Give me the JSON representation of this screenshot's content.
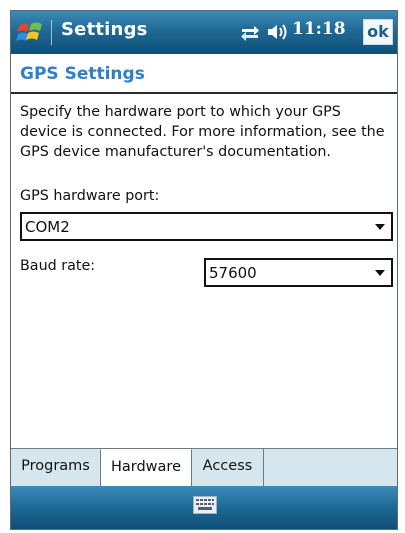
{
  "titlebar": {
    "app_title": "Settings",
    "time": "11:18",
    "ok_label": "ok",
    "icons": [
      "windows-start-icon",
      "connectivity-icon",
      "volume-icon"
    ]
  },
  "page": {
    "title": "GPS Settings",
    "description": "Specify the hardware port to which your GPS device is connected. For more information, see the GPS device manufacturer's documentation."
  },
  "form": {
    "port_label": "GPS hardware port:",
    "port_value": "COM2",
    "baud_label": "Baud rate:",
    "baud_value": "57600"
  },
  "tabs": [
    {
      "label": "Programs",
      "active": false
    },
    {
      "label": "Hardware",
      "active": true
    },
    {
      "label": "Access",
      "active": false
    }
  ],
  "bottombar": {
    "icon": "keyboard-icon"
  },
  "colors": {
    "title_accent": "#2f7fc4",
    "bar_blue": "#1f6994",
    "tab_inactive": "#d6e6ef"
  }
}
